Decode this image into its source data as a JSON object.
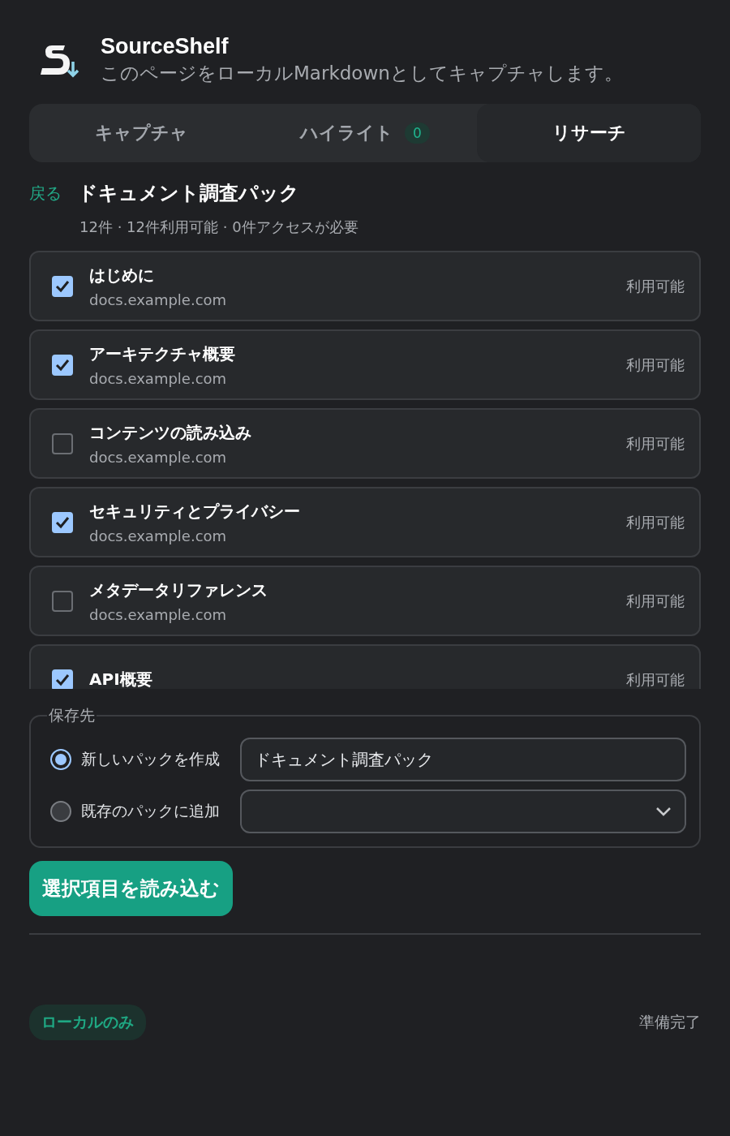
{
  "header": {
    "title": "SourceShelf",
    "subtitle": "このページをローカルMarkdownとしてキャプチャします。"
  },
  "tabs": [
    {
      "label": "キャプチャ",
      "selected": false
    },
    {
      "label": "ハイライト",
      "selected": false,
      "count": "0"
    },
    {
      "label": "リサーチ",
      "selected": true
    }
  ],
  "pack": {
    "back": "戻る",
    "title": "ドキュメント調査パック",
    "summary": "12件 · 12件利用可能 · 0件アクセスが必要"
  },
  "items": [
    {
      "title": "はじめに",
      "url": "docs.example.com",
      "status": "利用可能",
      "checked": true
    },
    {
      "title": "アーキテクチャ概要",
      "url": "docs.example.com",
      "status": "利用可能",
      "checked": true
    },
    {
      "title": "コンテンツの読み込み",
      "url": "docs.example.com",
      "status": "利用可能",
      "checked": false
    },
    {
      "title": "セキュリティとプライバシー",
      "url": "docs.example.com",
      "status": "利用可能",
      "checked": true
    },
    {
      "title": "メタデータリファレンス",
      "url": "docs.example.com",
      "status": "利用可能",
      "checked": false
    },
    {
      "title": "API概要",
      "status": "利用可能",
      "checked": true
    }
  ],
  "destination": {
    "legend": "保存先",
    "options": [
      {
        "label": "新しいパックを作成",
        "selected": true,
        "kind": "text",
        "value": "ドキュメント調査パック"
      },
      {
        "label": "既存のパックに追加",
        "selected": false,
        "kind": "select"
      }
    ]
  },
  "import_button": "選択項目を読み込む",
  "footer": {
    "badge": "ローカルのみ",
    "status": "準備完了"
  }
}
